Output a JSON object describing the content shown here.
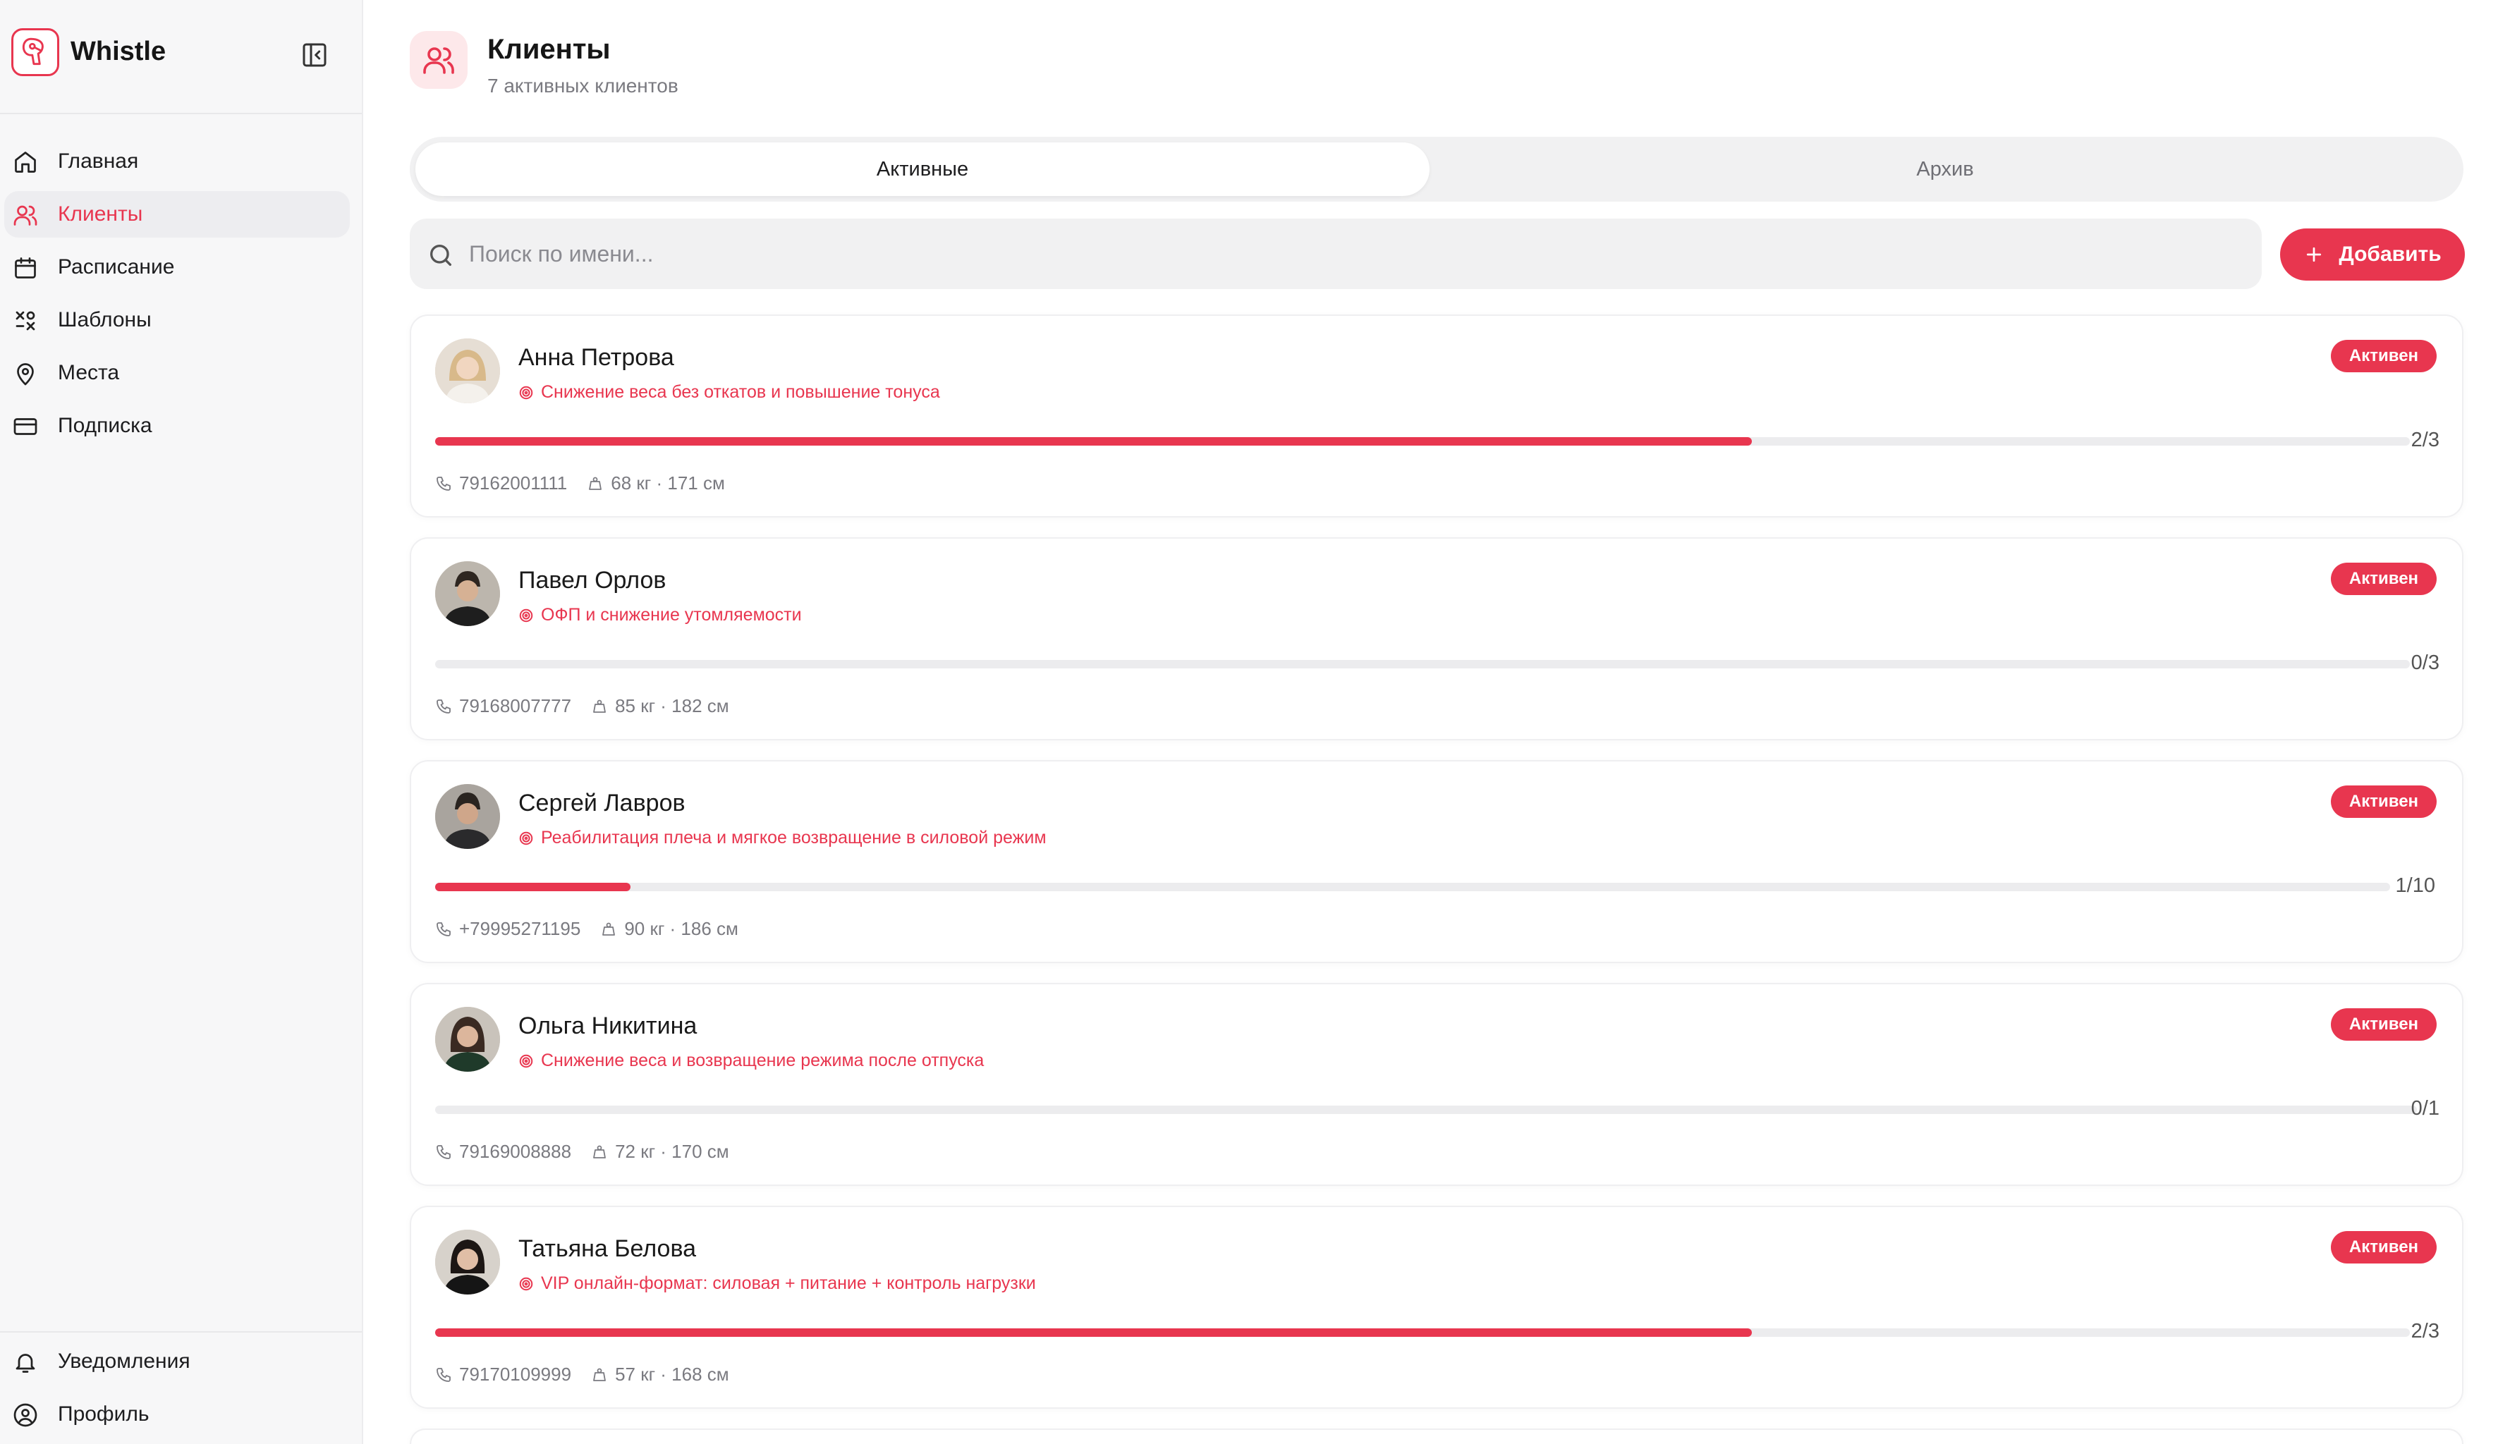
{
  "app": {
    "name": "Whistle"
  },
  "sidebar": {
    "items": [
      {
        "label": "Главная",
        "icon": "home-icon",
        "active": false
      },
      {
        "label": "Клиенты",
        "icon": "users-icon",
        "active": true
      },
      {
        "label": "Расписание",
        "icon": "calendar-icon",
        "active": false
      },
      {
        "label": "Шаблоны",
        "icon": "templates-icon",
        "active": false
      },
      {
        "label": "Места",
        "icon": "map-pin-icon",
        "active": false
      },
      {
        "label": "Подписка",
        "icon": "credit-card-icon",
        "active": false
      }
    ],
    "bottom": [
      {
        "label": "Уведомления",
        "icon": "bell-icon"
      },
      {
        "label": "Профиль",
        "icon": "user-circle-icon"
      }
    ]
  },
  "page": {
    "title": "Клиенты",
    "subtitle": "7 активных клиентов"
  },
  "tabs": {
    "active": "Активные",
    "archive": "Архив"
  },
  "search": {
    "placeholder": "Поиск по имени..."
  },
  "add_button": {
    "label": "Добавить"
  },
  "colors": {
    "accent": "#e8364f",
    "muted": "#7a7a80",
    "track": "#ececee"
  },
  "clients": [
    {
      "name": "Анна Петрова",
      "goal": "Снижение веса без откатов и повышение тонуса",
      "status": "Активен",
      "progress_done": 2,
      "progress_total": 3,
      "progress_label": "2/3",
      "phone": "79162001111",
      "body": "68 кг · 171 см"
    },
    {
      "name": "Павел Орлов",
      "goal": "ОФП и снижение утомляемости",
      "status": "Активен",
      "progress_done": 0,
      "progress_total": 3,
      "progress_label": "0/3",
      "phone": "79168007777",
      "body": "85 кг · 182 см"
    },
    {
      "name": "Сергей Лавров",
      "goal": "Реабилитация плеча и мягкое возвращение в силовой режим",
      "status": "Активен",
      "progress_done": 1,
      "progress_total": 10,
      "progress_label": "1/10",
      "phone": "+79995271195",
      "body": "90 кг · 186 см"
    },
    {
      "name": "Ольга Никитина",
      "goal": "Снижение веса и возвращение режима после отпуска",
      "status": "Активен",
      "progress_done": 0,
      "progress_total": 1,
      "progress_label": "0/1",
      "phone": "79169008888",
      "body": "72 кг · 170 см"
    },
    {
      "name": "Татьяна Белова",
      "goal": "VIP онлайн-формат: силовая + питание + контроль нагрузки",
      "status": "Активен",
      "progress_done": 2,
      "progress_total": 3,
      "progress_label": "2/3",
      "phone": "79170109999",
      "body": "57 кг · 168 см"
    }
  ]
}
